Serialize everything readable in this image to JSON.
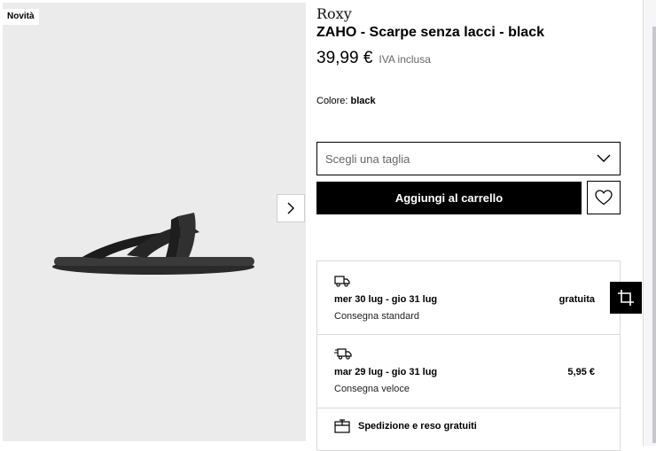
{
  "gallery": {
    "badge": "Novità",
    "image_alt": "sandal-photo"
  },
  "product": {
    "brand": "Roxy",
    "title": "ZAHO - Scarpe senza lacci - black",
    "price": "39,99 €",
    "vat_note": "IVA inclusa",
    "color_label": "Colore:",
    "color_value": "black"
  },
  "size_select": {
    "placeholder": "Scegli una taglia"
  },
  "actions": {
    "add_to_cart": "Aggiungi al carrello"
  },
  "shipping": {
    "options": [
      {
        "dates": "mer 30 lug - gio 31 lug",
        "price": "gratuita",
        "method": "Consegna standard"
      },
      {
        "dates": "mar 29 lug - gio 31 lug",
        "price": "5,95 €",
        "method": "Consegna veloce"
      }
    ],
    "free_returns": "Spedizione e reso gratuiti"
  }
}
